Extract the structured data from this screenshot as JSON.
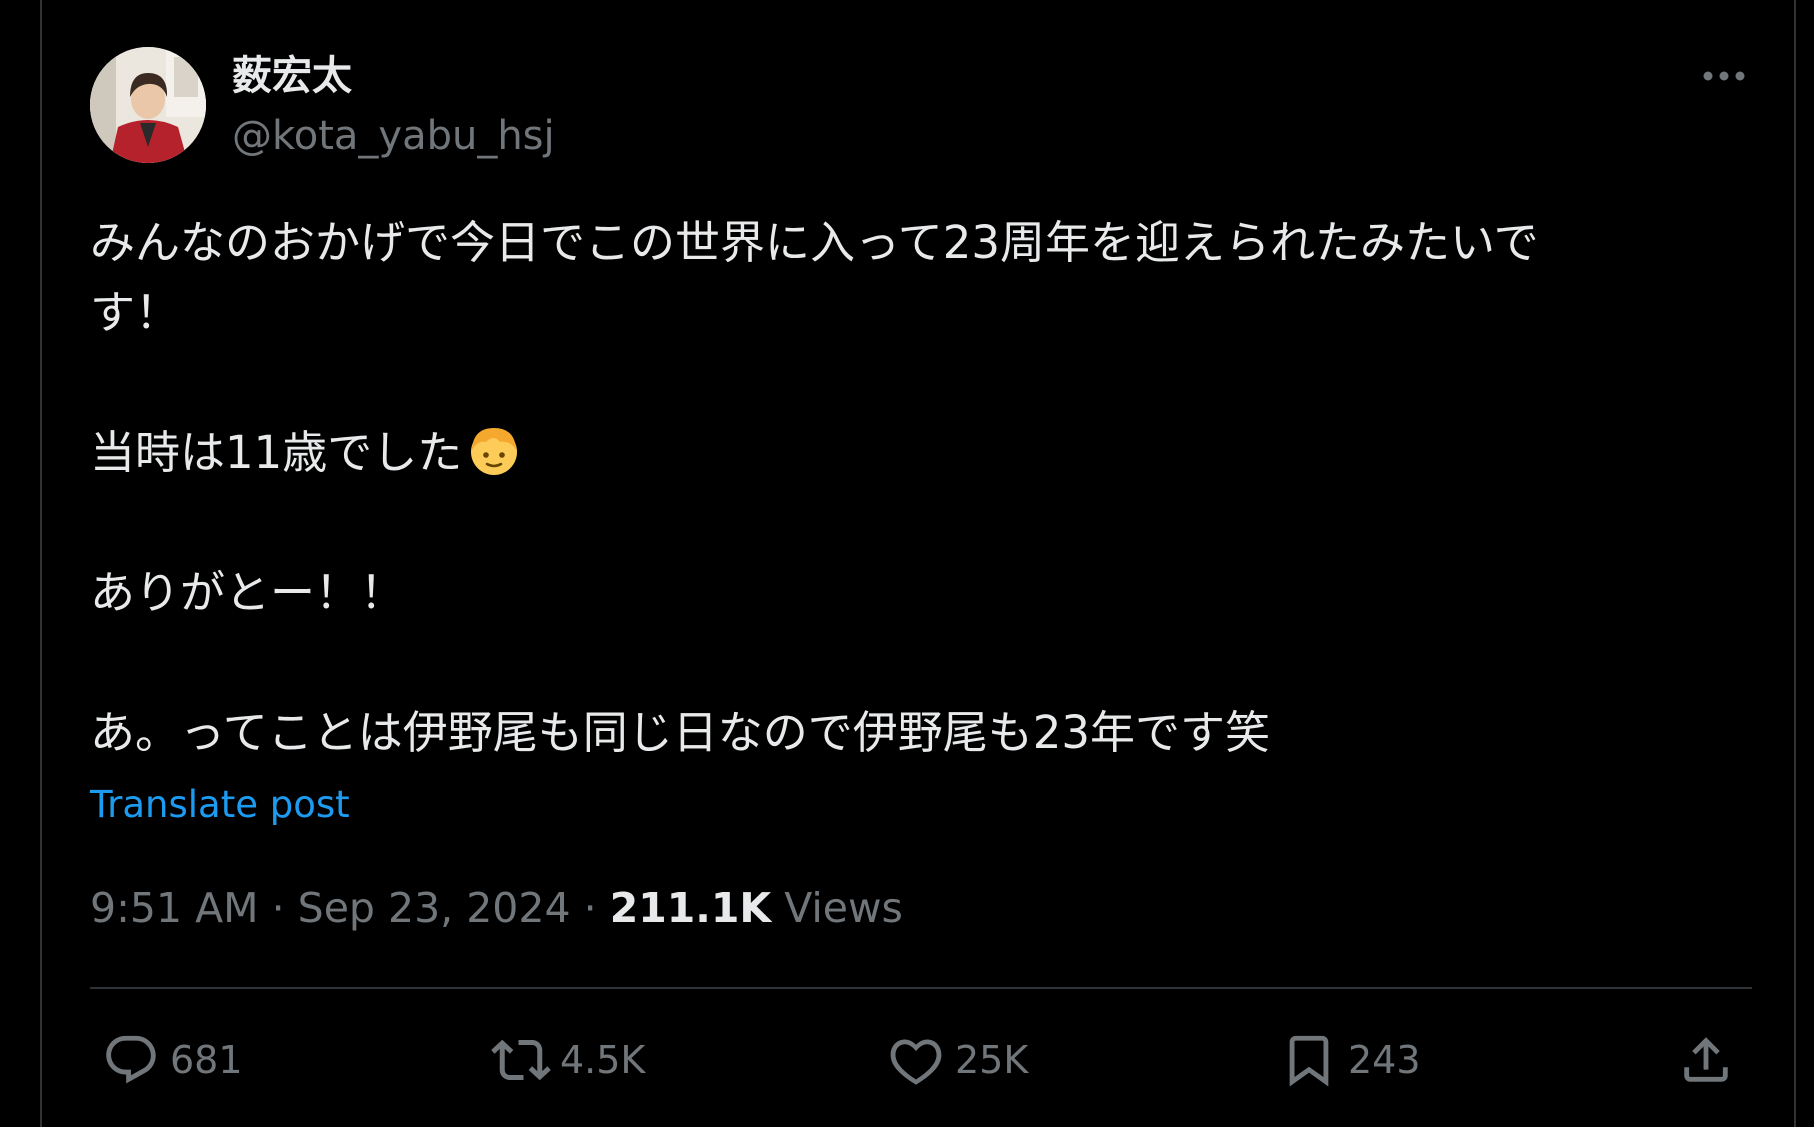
{
  "user": {
    "display_name": "薮宏太",
    "handle": "@kota_yabu_hsj"
  },
  "tweet": {
    "line1": "みんなのおかげで今日でこの世界に入って23周年を迎えられたみたいで",
    "line2": "す！",
    "line3": "当時は11歳でした",
    "line3_emoji": "boy-face-emoji",
    "line4": "ありがとー！！",
    "line5": "あ。ってことは伊野尾も同じ日なので伊野尾も23年です笑",
    "translate_label": "Translate post"
  },
  "meta": {
    "time": "9:51 AM",
    "separator": "·",
    "date": "Sep 23, 2024",
    "views_count": "211.1K",
    "views_label": "Views"
  },
  "actions": {
    "replies": "681",
    "reposts": "4.5K",
    "likes": "25K",
    "bookmarks": "243"
  },
  "colors": {
    "background": "#000000",
    "text": "#e7e9ea",
    "secondary": "#71767b",
    "link": "#1d9bf0",
    "border": "#2f3336"
  },
  "icons": {
    "more": "more-horizontal-icon",
    "reply": "reply-bubble-icon",
    "repost": "repost-arrows-icon",
    "like": "heart-icon",
    "bookmark": "bookmark-icon",
    "share": "share-upload-icon"
  }
}
